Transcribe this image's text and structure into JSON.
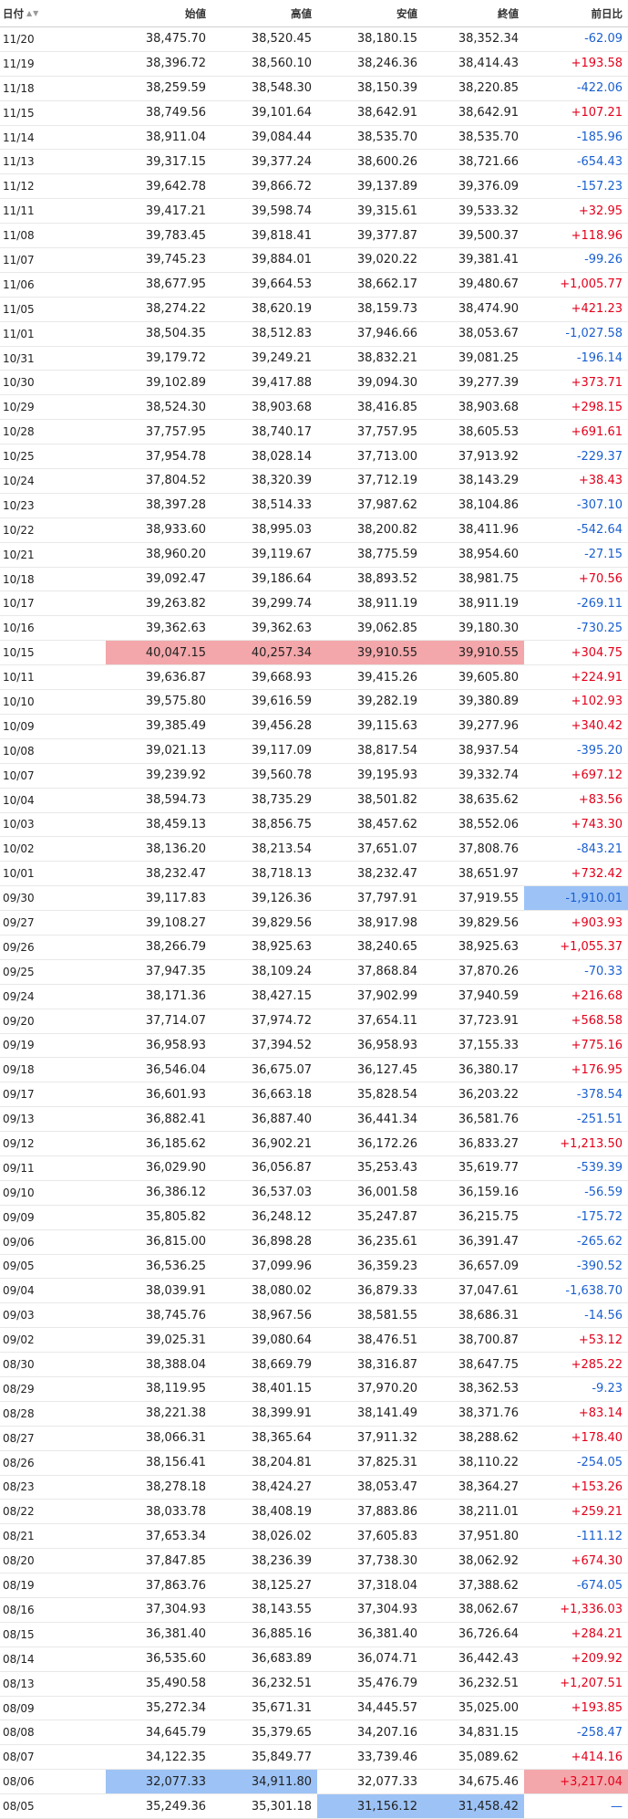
{
  "header": {
    "date": "日付",
    "open": "始値",
    "high": "高値",
    "low": "安値",
    "close": "終値",
    "change": "前日比",
    "sort_asc": "▲",
    "sort_desc": "▼"
  },
  "highlight_colors": {
    "red": "#f3a7aa",
    "blue": "#9dc3f6",
    "up": "#e4001b",
    "down": "#1a5fd0"
  },
  "rows": [
    {
      "date": "11/20",
      "open": "38,475.70",
      "high": "38,520.45",
      "low": "38,180.15",
      "close": "38,352.34",
      "change": "-62.09"
    },
    {
      "date": "11/19",
      "open": "38,396.72",
      "high": "38,560.10",
      "low": "38,246.36",
      "close": "38,414.43",
      "change": "+193.58"
    },
    {
      "date": "11/18",
      "open": "38,259.59",
      "high": "38,548.30",
      "low": "38,150.39",
      "close": "38,220.85",
      "change": "-422.06"
    },
    {
      "date": "11/15",
      "open": "38,749.56",
      "high": "39,101.64",
      "low": "38,642.91",
      "close": "38,642.91",
      "change": "+107.21"
    },
    {
      "date": "11/14",
      "open": "38,911.04",
      "high": "39,084.44",
      "low": "38,535.70",
      "close": "38,535.70",
      "change": "-185.96"
    },
    {
      "date": "11/13",
      "open": "39,317.15",
      "high": "39,377.24",
      "low": "38,600.26",
      "close": "38,721.66",
      "change": "-654.43"
    },
    {
      "date": "11/12",
      "open": "39,642.78",
      "high": "39,866.72",
      "low": "39,137.89",
      "close": "39,376.09",
      "change": "-157.23"
    },
    {
      "date": "11/11",
      "open": "39,417.21",
      "high": "39,598.74",
      "low": "39,315.61",
      "close": "39,533.32",
      "change": "+32.95"
    },
    {
      "date": "11/08",
      "open": "39,783.45",
      "high": "39,818.41",
      "low": "39,377.87",
      "close": "39,500.37",
      "change": "+118.96"
    },
    {
      "date": "11/07",
      "open": "39,745.23",
      "high": "39,884.01",
      "low": "39,020.22",
      "close": "39,381.41",
      "change": "-99.26"
    },
    {
      "date": "11/06",
      "open": "38,677.95",
      "high": "39,664.53",
      "low": "38,662.17",
      "close": "39,480.67",
      "change": "+1,005.77"
    },
    {
      "date": "11/05",
      "open": "38,274.22",
      "high": "38,620.19",
      "low": "38,159.73",
      "close": "38,474.90",
      "change": "+421.23"
    },
    {
      "date": "11/01",
      "open": "38,504.35",
      "high": "38,512.83",
      "low": "37,946.66",
      "close": "38,053.67",
      "change": "-1,027.58"
    },
    {
      "date": "10/31",
      "open": "39,179.72",
      "high": "39,249.21",
      "low": "38,832.21",
      "close": "39,081.25",
      "change": "-196.14"
    },
    {
      "date": "10/30",
      "open": "39,102.89",
      "high": "39,417.88",
      "low": "39,094.30",
      "close": "39,277.39",
      "change": "+373.71"
    },
    {
      "date": "10/29",
      "open": "38,524.30",
      "high": "38,903.68",
      "low": "38,416.85",
      "close": "38,903.68",
      "change": "+298.15"
    },
    {
      "date": "10/28",
      "open": "37,757.95",
      "high": "38,740.17",
      "low": "37,757.95",
      "close": "38,605.53",
      "change": "+691.61"
    },
    {
      "date": "10/25",
      "open": "37,954.78",
      "high": "38,028.14",
      "low": "37,713.00",
      "close": "37,913.92",
      "change": "-229.37"
    },
    {
      "date": "10/24",
      "open": "37,804.52",
      "high": "38,320.39",
      "low": "37,712.19",
      "close": "38,143.29",
      "change": "+38.43"
    },
    {
      "date": "10/23",
      "open": "38,397.28",
      "high": "38,514.33",
      "low": "37,987.62",
      "close": "38,104.86",
      "change": "-307.10"
    },
    {
      "date": "10/22",
      "open": "38,933.60",
      "high": "38,995.03",
      "low": "38,200.82",
      "close": "38,411.96",
      "change": "-542.64"
    },
    {
      "date": "10/21",
      "open": "38,960.20",
      "high": "39,119.67",
      "low": "38,775.59",
      "close": "38,954.60",
      "change": "-27.15"
    },
    {
      "date": "10/18",
      "open": "39,092.47",
      "high": "39,186.64",
      "low": "38,893.52",
      "close": "38,981.75",
      "change": "+70.56"
    },
    {
      "date": "10/17",
      "open": "39,263.82",
      "high": "39,299.74",
      "low": "38,911.19",
      "close": "38,911.19",
      "change": "-269.11"
    },
    {
      "date": "10/16",
      "open": "39,362.63",
      "high": "39,362.63",
      "low": "39,062.85",
      "close": "39,180.30",
      "change": "-730.25"
    },
    {
      "date": "10/15",
      "open": "40,047.15",
      "high": "40,257.34",
      "low": "39,910.55",
      "close": "39,910.55",
      "change": "+304.75"
    },
    {
      "date": "10/11",
      "open": "39,636.87",
      "high": "39,668.93",
      "low": "39,415.26",
      "close": "39,605.80",
      "change": "+224.91"
    },
    {
      "date": "10/10",
      "open": "39,575.80",
      "high": "39,616.59",
      "low": "39,282.19",
      "close": "39,380.89",
      "change": "+102.93"
    },
    {
      "date": "10/09",
      "open": "39,385.49",
      "high": "39,456.28",
      "low": "39,115.63",
      "close": "39,277.96",
      "change": "+340.42"
    },
    {
      "date": "10/08",
      "open": "39,021.13",
      "high": "39,117.09",
      "low": "38,817.54",
      "close": "38,937.54",
      "change": "-395.20"
    },
    {
      "date": "10/07",
      "open": "39,239.92",
      "high": "39,560.78",
      "low": "39,195.93",
      "close": "39,332.74",
      "change": "+697.12"
    },
    {
      "date": "10/04",
      "open": "38,594.73",
      "high": "38,735.29",
      "low": "38,501.82",
      "close": "38,635.62",
      "change": "+83.56"
    },
    {
      "date": "10/03",
      "open": "38,459.13",
      "high": "38,856.75",
      "low": "38,457.62",
      "close": "38,552.06",
      "change": "+743.30"
    },
    {
      "date": "10/02",
      "open": "38,136.20",
      "high": "38,213.54",
      "low": "37,651.07",
      "close": "37,808.76",
      "change": "-843.21"
    },
    {
      "date": "10/01",
      "open": "38,232.47",
      "high": "38,718.13",
      "low": "38,232.47",
      "close": "38,651.97",
      "change": "+732.42"
    },
    {
      "date": "09/30",
      "open": "39,117.83",
      "high": "39,126.36",
      "low": "37,797.91",
      "close": "37,919.55",
      "change": "-1,910.01"
    },
    {
      "date": "09/27",
      "open": "39,108.27",
      "high": "39,829.56",
      "low": "38,917.98",
      "close": "39,829.56",
      "change": "+903.93"
    },
    {
      "date": "09/26",
      "open": "38,266.79",
      "high": "38,925.63",
      "low": "38,240.65",
      "close": "38,925.63",
      "change": "+1,055.37"
    },
    {
      "date": "09/25",
      "open": "37,947.35",
      "high": "38,109.24",
      "low": "37,868.84",
      "close": "37,870.26",
      "change": "-70.33"
    },
    {
      "date": "09/24",
      "open": "38,171.36",
      "high": "38,427.15",
      "low": "37,902.99",
      "close": "37,940.59",
      "change": "+216.68"
    },
    {
      "date": "09/20",
      "open": "37,714.07",
      "high": "37,974.72",
      "low": "37,654.11",
      "close": "37,723.91",
      "change": "+568.58"
    },
    {
      "date": "09/19",
      "open": "36,958.93",
      "high": "37,394.52",
      "low": "36,958.93",
      "close": "37,155.33",
      "change": "+775.16"
    },
    {
      "date": "09/18",
      "open": "36,546.04",
      "high": "36,675.07",
      "low": "36,127.45",
      "close": "36,380.17",
      "change": "+176.95"
    },
    {
      "date": "09/17",
      "open": "36,601.93",
      "high": "36,663.18",
      "low": "35,828.54",
      "close": "36,203.22",
      "change": "-378.54"
    },
    {
      "date": "09/13",
      "open": "36,882.41",
      "high": "36,887.40",
      "low": "36,441.34",
      "close": "36,581.76",
      "change": "-251.51"
    },
    {
      "date": "09/12",
      "open": "36,185.62",
      "high": "36,902.21",
      "low": "36,172.26",
      "close": "36,833.27",
      "change": "+1,213.50"
    },
    {
      "date": "09/11",
      "open": "36,029.90",
      "high": "36,056.87",
      "low": "35,253.43",
      "close": "35,619.77",
      "change": "-539.39"
    },
    {
      "date": "09/10",
      "open": "36,386.12",
      "high": "36,537.03",
      "low": "36,001.58",
      "close": "36,159.16",
      "change": "-56.59"
    },
    {
      "date": "09/09",
      "open": "35,805.82",
      "high": "36,248.12",
      "low": "35,247.87",
      "close": "36,215.75",
      "change": "-175.72"
    },
    {
      "date": "09/06",
      "open": "36,815.00",
      "high": "36,898.28",
      "low": "36,235.61",
      "close": "36,391.47",
      "change": "-265.62"
    },
    {
      "date": "09/05",
      "open": "36,536.25",
      "high": "37,099.96",
      "low": "36,359.23",
      "close": "36,657.09",
      "change": "-390.52"
    },
    {
      "date": "09/04",
      "open": "38,039.91",
      "high": "38,080.02",
      "low": "36,879.33",
      "close": "37,047.61",
      "change": "-1,638.70"
    },
    {
      "date": "09/03",
      "open": "38,745.76",
      "high": "38,967.56",
      "low": "38,581.55",
      "close": "38,686.31",
      "change": "-14.56"
    },
    {
      "date": "09/02",
      "open": "39,025.31",
      "high": "39,080.64",
      "low": "38,476.51",
      "close": "38,700.87",
      "change": "+53.12"
    },
    {
      "date": "08/30",
      "open": "38,388.04",
      "high": "38,669.79",
      "low": "38,316.87",
      "close": "38,647.75",
      "change": "+285.22"
    },
    {
      "date": "08/29",
      "open": "38,119.95",
      "high": "38,401.15",
      "low": "37,970.20",
      "close": "38,362.53",
      "change": "-9.23"
    },
    {
      "date": "08/28",
      "open": "38,221.38",
      "high": "38,399.91",
      "low": "38,141.49",
      "close": "38,371.76",
      "change": "+83.14"
    },
    {
      "date": "08/27",
      "open": "38,066.31",
      "high": "38,365.64",
      "low": "37,911.32",
      "close": "38,288.62",
      "change": "+178.40"
    },
    {
      "date": "08/26",
      "open": "38,156.41",
      "high": "38,204.81",
      "low": "37,825.31",
      "close": "38,110.22",
      "change": "-254.05"
    },
    {
      "date": "08/23",
      "open": "38,278.18",
      "high": "38,424.27",
      "low": "38,053.47",
      "close": "38,364.27",
      "change": "+153.26"
    },
    {
      "date": "08/22",
      "open": "38,033.78",
      "high": "38,408.19",
      "low": "37,883.86",
      "close": "38,211.01",
      "change": "+259.21"
    },
    {
      "date": "08/21",
      "open": "37,653.34",
      "high": "38,026.02",
      "low": "37,605.83",
      "close": "37,951.80",
      "change": "-111.12"
    },
    {
      "date": "08/20",
      "open": "37,847.85",
      "high": "38,236.39",
      "low": "37,738.30",
      "close": "38,062.92",
      "change": "+674.30"
    },
    {
      "date": "08/19",
      "open": "37,863.76",
      "high": "38,125.27",
      "low": "37,318.04",
      "close": "37,388.62",
      "change": "-674.05"
    },
    {
      "date": "08/16",
      "open": "37,304.93",
      "high": "38,143.55",
      "low": "37,304.93",
      "close": "38,062.67",
      "change": "+1,336.03"
    },
    {
      "date": "08/15",
      "open": "36,381.40",
      "high": "36,885.16",
      "low": "36,381.40",
      "close": "36,726.64",
      "change": "+284.21"
    },
    {
      "date": "08/14",
      "open": "36,535.60",
      "high": "36,683.89",
      "low": "36,074.71",
      "close": "36,442.43",
      "change": "+209.92"
    },
    {
      "date": "08/13",
      "open": "35,490.58",
      "high": "36,232.51",
      "low": "35,476.79",
      "close": "36,232.51",
      "change": "+1,207.51"
    },
    {
      "date": "08/09",
      "open": "35,272.34",
      "high": "35,671.31",
      "low": "34,445.57",
      "close": "35,025.00",
      "change": "+193.85"
    },
    {
      "date": "08/08",
      "open": "34,645.79",
      "high": "35,379.65",
      "low": "34,207.16",
      "close": "34,831.15",
      "change": "-258.47"
    },
    {
      "date": "08/07",
      "open": "34,122.35",
      "high": "35,849.77",
      "low": "33,739.46",
      "close": "35,089.62",
      "change": "+414.16"
    },
    {
      "date": "08/06",
      "open": "32,077.33",
      "high": "34,911.80",
      "low": "32,077.33",
      "close": "34,675.46",
      "change": "+3,217.04"
    },
    {
      "date": "08/05",
      "open": "35,249.36",
      "high": "35,301.18",
      "low": "31,156.12",
      "close": "31,458.42",
      "change": "—"
    }
  ],
  "highlights": {
    "10/15": {
      "open": "red",
      "high": "red",
      "low": "red",
      "close": "red"
    },
    "09/30": {
      "change": "blue"
    },
    "08/06": {
      "open": "blue",
      "high": "blue",
      "change": "red"
    },
    "08/05": {
      "low": "blue",
      "close": "blue"
    }
  }
}
